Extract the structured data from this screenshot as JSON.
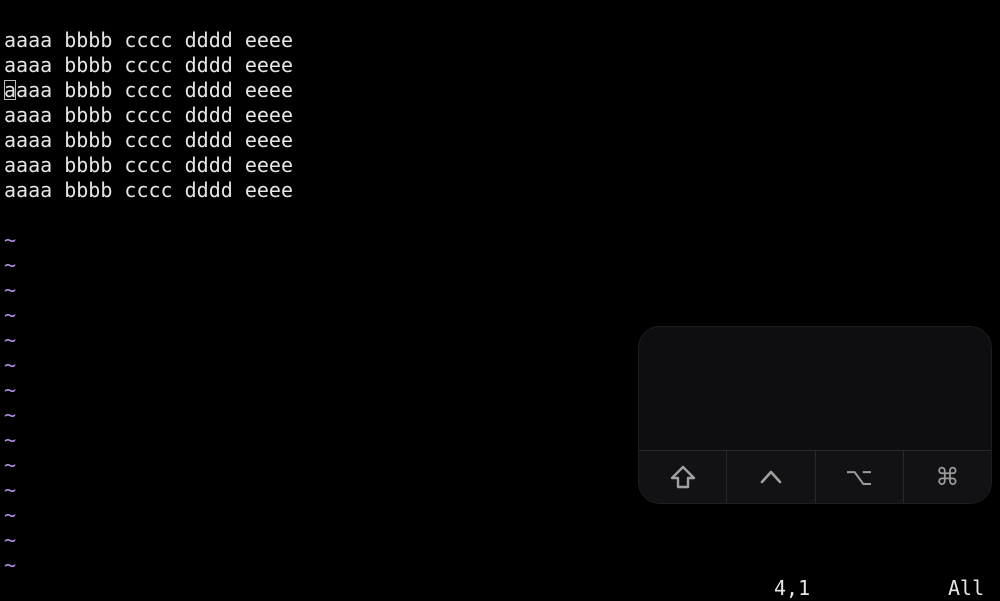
{
  "buffer": {
    "lines": [
      "aaaa bbbb cccc dddd eeee",
      "aaaa bbbb cccc dddd eeee",
      "aaaa bbbb cccc dddd eeee",
      "aaaa bbbb cccc dddd eeee",
      "aaaa bbbb cccc dddd eeee",
      "aaaa bbbb cccc dddd eeee",
      "aaaa bbbb cccc dddd eeee"
    ],
    "cursor_char": "a",
    "cursor_line_rest": "aaa bbbb cccc dddd eeee",
    "tilde": "~"
  },
  "status": {
    "position": "4,1",
    "scroll": "All"
  },
  "modifier_keys": [
    {
      "name": "shift",
      "icon": "shift-icon"
    },
    {
      "name": "control",
      "icon": "control-icon",
      "glyph": "^"
    },
    {
      "name": "option",
      "icon": "option-icon",
      "glyph": "⌥"
    },
    {
      "name": "command",
      "icon": "command-icon",
      "glyph": "⌘"
    }
  ],
  "colors": {
    "background": "#000000",
    "text": "#e6e6e6",
    "tilde": "#b48ee8"
  }
}
